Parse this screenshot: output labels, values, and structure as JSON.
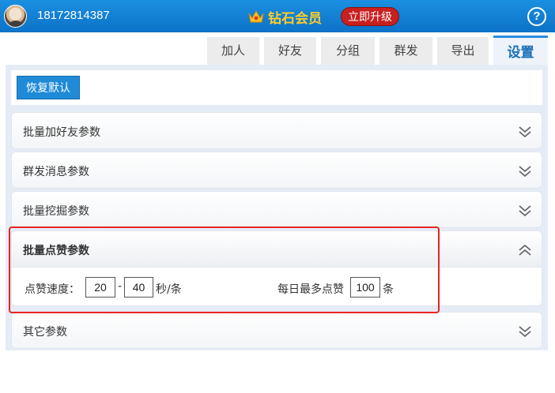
{
  "header": {
    "phone": "18172814387",
    "vip_label": "钻石会员",
    "upgrade_label": "立即升级",
    "help_glyph": "?",
    "vip_color": "#ffcc26",
    "brand_color": "#1b8fe0"
  },
  "tabs": [
    {
      "label": "加人",
      "active": false
    },
    {
      "label": "好友",
      "active": false
    },
    {
      "label": "分组",
      "active": false
    },
    {
      "label": "群发",
      "active": false
    },
    {
      "label": "导出",
      "active": false
    },
    {
      "label": "设置",
      "active": true
    }
  ],
  "restore_label": "恢复默认",
  "sections": [
    {
      "title": "批量加好友参数",
      "state": "collapsed",
      "icon": "chevron-double-down-icon"
    },
    {
      "title": "群发消息参数",
      "state": "collapsed",
      "icon": "chevron-double-down-icon"
    },
    {
      "title": "批量挖掘参数",
      "state": "collapsed",
      "icon": "chevron-double-down-icon"
    },
    {
      "title": "批量点赞参数",
      "state": "expanded",
      "icon": "chevron-double-up-icon"
    },
    {
      "title": "其它参数",
      "state": "collapsed",
      "icon": "chevron-double-down-icon"
    }
  ],
  "like_params": {
    "speed_label": "点赞速度：",
    "speed_min": "20",
    "dash": "-",
    "speed_max": "40",
    "speed_unit": "秒/条",
    "daily_max_label": "每日最多点赞",
    "daily_max": "100",
    "daily_unit": "条"
  },
  "highlight_color": "#e62424"
}
